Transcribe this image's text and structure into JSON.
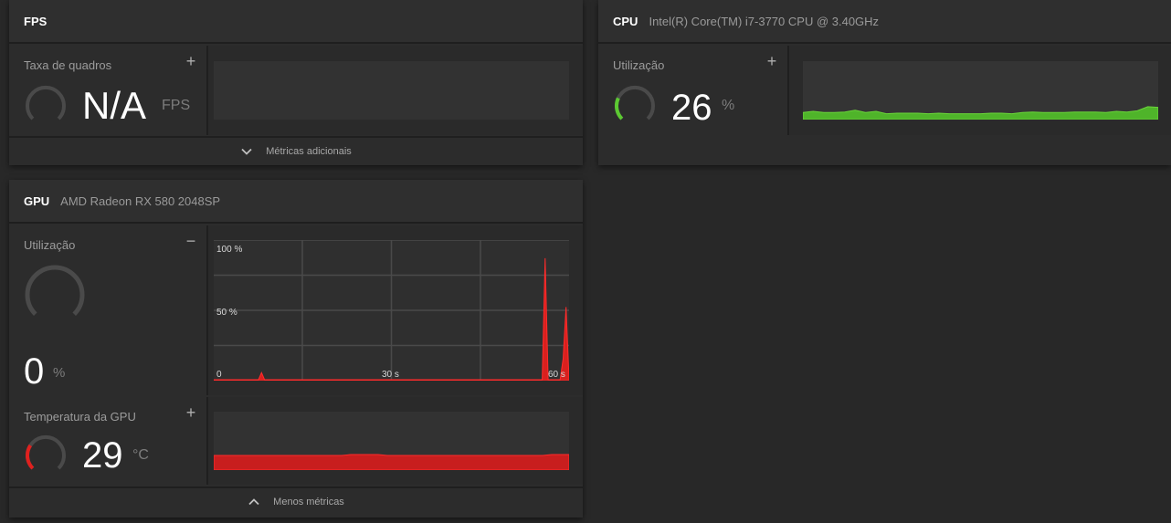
{
  "fps_panel": {
    "title": "FPS",
    "metric_label": "Taxa de quadros",
    "toggle": "+",
    "value": "N/A",
    "unit": "FPS",
    "footer_label": "Métricas adicionais",
    "footer_icon": "chevron-down-icon"
  },
  "cpu_panel": {
    "title": "CPU",
    "subtitle": "Intel(R) Core(TM) i7-3770 CPU @ 3.40GHz",
    "metric_label": "Utilização",
    "toggle": "+",
    "value": "26",
    "value_fraction": 0.26,
    "unit": "%",
    "accent_color": "#5cc932",
    "history_percent": [
      12,
      14,
      12,
      12,
      13,
      16,
      12,
      14,
      10,
      11,
      11,
      11,
      10,
      11,
      10,
      10,
      10,
      10,
      11,
      11,
      10,
      12,
      13,
      12,
      12,
      12,
      13,
      13,
      13,
      12,
      14,
      13,
      15,
      22,
      21
    ]
  },
  "gpu_panel": {
    "title": "GPU",
    "subtitle": "AMD Radeon RX 580 2048SP",
    "util": {
      "label": "Utilização",
      "toggle": "−",
      "value": "0",
      "value_fraction": 0.0,
      "unit": "%",
      "accent_color": "#e0201e",
      "y_labels": {
        "top": "100 %",
        "mid": "50 %",
        "bottom": "0"
      },
      "x_labels": {
        "mid": "30 s",
        "end": "60 s"
      },
      "history_percent": [
        0,
        0,
        0,
        0,
        0,
        0,
        0,
        0,
        0,
        0,
        0,
        0,
        0,
        0,
        0,
        0,
        5,
        0,
        0,
        0,
        0,
        0,
        0,
        0,
        0,
        0,
        0,
        0,
        0,
        0,
        0,
        0,
        0,
        0,
        0,
        0,
        0,
        0,
        0,
        0,
        0,
        0,
        0,
        0,
        0,
        0,
        0,
        0,
        0,
        0,
        0,
        0,
        0,
        0,
        0,
        0,
        0,
        0,
        0,
        0,
        0,
        0,
        0,
        0,
        0,
        0,
        0,
        0,
        0,
        0,
        0,
        0,
        0,
        0,
        0,
        0,
        0,
        0,
        0,
        0,
        0,
        0,
        0,
        0,
        0,
        0,
        0,
        0,
        0,
        0,
        0,
        0,
        0,
        0,
        0,
        0,
        0,
        0,
        0,
        0,
        0,
        0,
        0,
        0,
        0,
        0,
        0,
        0,
        0,
        0,
        0,
        87,
        0,
        0,
        0,
        0,
        0,
        15,
        52,
        0
      ]
    },
    "temp": {
      "label": "Temperatura da GPU",
      "toggle": "+",
      "value": "29",
      "unit": "°C",
      "value_fraction": 0.29,
      "accent_color": "#e0201e"
    },
    "footer_label": "Menos métricas",
    "footer_icon": "chevron-up-icon"
  }
}
